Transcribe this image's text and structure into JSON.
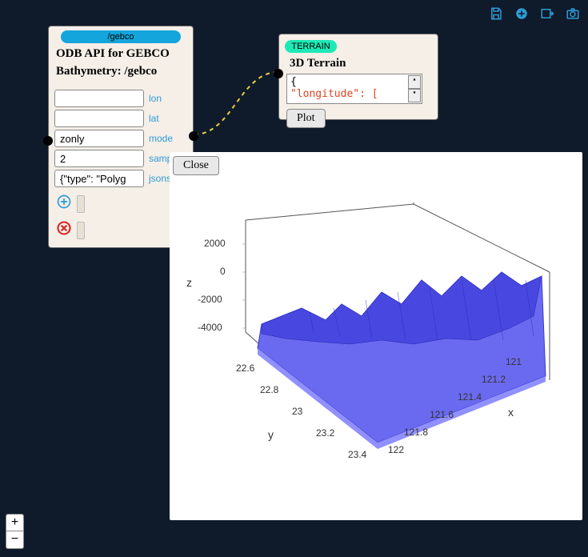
{
  "toolbar": {
    "save": "save-icon",
    "add": "plus-circle-icon",
    "export": "export-icon",
    "camera": "camera-icon"
  },
  "gebco": {
    "pill": "/gebco",
    "title_line1": "ODB API for GEBCO",
    "title_line2": "Bathymetry: /gebco",
    "fields": {
      "lon": {
        "label": "lon",
        "value": ""
      },
      "lat": {
        "label": "lat",
        "value": ""
      },
      "mode": {
        "label": "mode",
        "value": "zonly"
      },
      "sample": {
        "label": "sample",
        "value": "2"
      },
      "jsonsrc": {
        "label": "jsonsrc",
        "value": "{\"type\": \"Polyg"
      }
    }
  },
  "terrain": {
    "pill": "TERRAIN",
    "title": "3D Terrain",
    "code_line1": "{",
    "code_line2": "  \"longitude\": [",
    "plot_label": "Plot"
  },
  "close_label": "Close",
  "zoom": {
    "in": "+",
    "out": "−"
  },
  "chart_data": {
    "type": "surface3d",
    "z_axis": {
      "label": "z",
      "ticks": [
        2000,
        0,
        -2000,
        -4000
      ]
    },
    "y_axis": {
      "label": "y",
      "ticks": [
        22.6,
        22.8,
        23,
        23.2,
        23.4
      ]
    },
    "x_axis": {
      "label": "x",
      "ticks": [
        121,
        121.2,
        121.4,
        121.6,
        121.8,
        122
      ]
    },
    "surface_color": "#5858e8",
    "z_range": [
      -5000,
      3000
    ],
    "description": "3D bathymetric/topographic terrain surface over lon 121–122°, lat 22.6–23.4°, elevation roughly -4000 to 2000 m; mountainous ridge along the northern/eastern edge dropping to deep ocean floor toward the south."
  }
}
